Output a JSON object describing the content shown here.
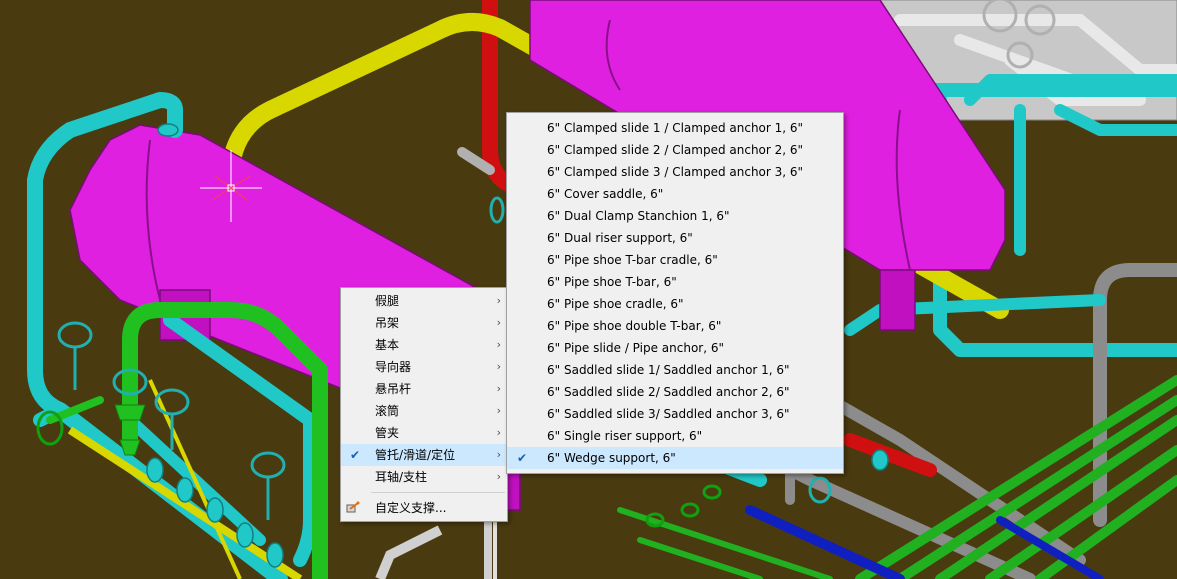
{
  "main_menu": {
    "items": [
      {
        "label": "假腿",
        "submenu": true
      },
      {
        "label": "吊架",
        "submenu": true
      },
      {
        "label": "基本",
        "submenu": true
      },
      {
        "label": "导向器",
        "submenu": true
      },
      {
        "label": "悬吊杆",
        "submenu": true
      },
      {
        "label": "滚筒",
        "submenu": true
      },
      {
        "label": "管夹",
        "submenu": true
      },
      {
        "label": "管托/滑道/定位",
        "submenu": true,
        "checked": true
      },
      {
        "label": "耳轴/支柱",
        "submenu": true
      }
    ],
    "custom_item": {
      "label": "自定义支撑...",
      "icon": "custom-support-icon"
    }
  },
  "sub_menu": {
    "items": [
      "6\" Clamped slide 1 / Clamped anchor 1, 6\"",
      "6\" Clamped slide 2 / Clamped anchor 2, 6\"",
      "6\" Clamped slide 3 / Clamped anchor 3, 6\"",
      "6\" Cover saddle, 6\"",
      "6\" Dual Clamp Stanchion 1, 6\"",
      "6\" Dual riser support, 6\"",
      "6\" Pipe shoe T-bar cradle, 6\"",
      "6\" Pipe shoe T-bar, 6\"",
      "6\" Pipe shoe cradle, 6\"",
      "6\" Pipe shoe double T-bar, 6\"",
      "6\" Pipe slide / Pipe anchor, 6\"",
      "6\" Saddled slide 1/ Saddled anchor 1, 6\"",
      "6\" Saddled slide 2/ Saddled anchor 2, 6\"",
      "6\" Saddled slide 3/ Saddled anchor 3, 6\"",
      "6\" Single riser support, 6\"",
      "6\" Wedge support, 6\""
    ]
  },
  "glyphs": {
    "check": "✔",
    "arrow": "›"
  },
  "colors": {
    "background": "#4a3a10",
    "vessel": "#e020e0",
    "pipe_cyan": "#20c8c8",
    "pipe_yellow": "#e0e000",
    "pipe_green": "#20c020",
    "pipe_red": "#d01010",
    "pipe_gray": "#909090",
    "pipe_blue": "#1020c0",
    "menu_bg": "#f0f0f0",
    "menu_highlight": "#cce8ff"
  }
}
